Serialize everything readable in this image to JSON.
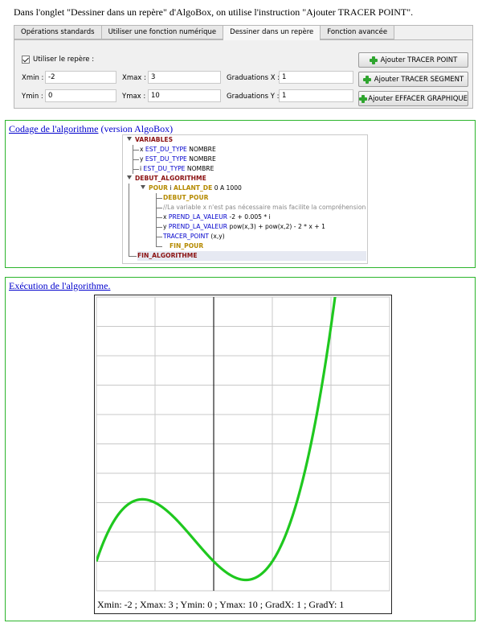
{
  "intro": "Dans l'onglet \"Dessiner dans un repère\" d'AlgoBox, on utilise l'instruction \"Ajouter TRACER POINT\".",
  "panel": {
    "tabs": [
      "Opérations standards",
      "Utiliser une fonction numérique",
      "Dessiner dans un repère",
      "Fonction avancée"
    ],
    "active_tab": 2,
    "checkbox_label": "Utiliser le repère :",
    "xmin_label": "Xmin :",
    "xmin_value": "-2",
    "xmax_label": "Xmax :",
    "xmax_value": "3",
    "gradx_label": "Graduations X :",
    "gradx_value": "1",
    "ymin_label": "Ymin :",
    "ymin_value": "0",
    "ymax_label": "Ymax :",
    "ymax_value": "10",
    "grady_label": "Graduations Y :",
    "grady_value": "1",
    "btn_point": "Ajouter TRACER POINT",
    "btn_segment": "Ajouter TRACER SEGMENT",
    "btn_effacer": "Ajouter EFFACER GRAPHIQUE"
  },
  "code_box": {
    "title_link": "Codage de l'algorithme",
    "title_rest": " (version AlgoBox)",
    "lines": {
      "variables": "VARIABLES",
      "x_name": "x",
      "x_kw": "EST_DU_TYPE",
      "x_type": "NOMBRE",
      "y_name": "y",
      "y_kw": "EST_DU_TYPE",
      "y_type": "NOMBRE",
      "i_name": "i",
      "i_kw": "EST_DU_TYPE",
      "i_type": "NOMBRE",
      "debut_algo": "DEBUT_ALGORITHME",
      "pour_kw": "POUR",
      "pour_var": "i",
      "pour_kw2": "ALLANT_DE",
      "pour_range": "0 A 1000",
      "debut_pour": "DEBUT_POUR",
      "comment": "//La variable x n'est pas nécessaire mais facilite la compréhension",
      "xassign_name": "x",
      "xassign_kw": "PREND_LA_VALEUR",
      "xassign_expr": "-2 + 0.005 * i",
      "yassign_name": "y",
      "yassign_kw": "PREND_LA_VALEUR",
      "yassign_expr": "pow(x,3) + pow(x,2) - 2 * x + 1",
      "tracer_kw": "TRACER_POINT",
      "tracer_args": "(x,y)",
      "fin_pour": "FIN_POUR",
      "fin_algo": "FIN_ALGORITHME"
    }
  },
  "exec_box": {
    "title_link": "Exécution de l'algorithme.",
    "footer": "Xmin: -2 ; Xmax: 3 ; Ymin: 0 ; Ymax: 10 ; GradX: 1 ; GradY: 1"
  },
  "chart_data": {
    "type": "line",
    "function": "x^3 + x^2 - 2x + 1",
    "xlim": [
      -2,
      3
    ],
    "ylim": [
      0,
      10
    ],
    "grad_x": 1,
    "grad_y": 1,
    "grid": true,
    "line_color": "#1fc81f",
    "x": [
      -2,
      -1.75,
      -1.5,
      -1.25,
      -1,
      -0.75,
      -0.5,
      -0.25,
      0,
      0.25,
      0.5,
      0.75,
      1,
      1.25,
      1.5,
      1.75,
      2,
      2.1
    ],
    "y": [
      1,
      2.078,
      2.625,
      2.734,
      2.5,
      2.016,
      1.375,
      0.672,
      1,
      0.578,
      0.375,
      0.484,
      1,
      2.016,
      3.625,
      5.922,
      9,
      10.471
    ]
  }
}
